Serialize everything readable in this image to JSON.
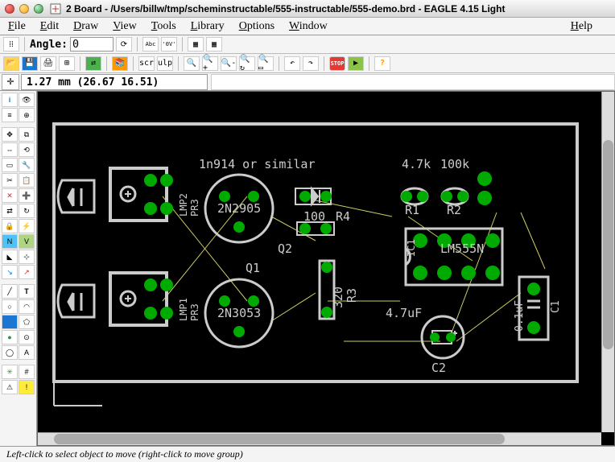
{
  "window": {
    "title": "2 Board - /Users/billw/tmp/scheminstructable/555-instructable/555-demo.brd - EAGLE 4.15 Light"
  },
  "menu": {
    "file": "File",
    "edit": "Edit",
    "draw": "Draw",
    "view": "View",
    "tools": "Tools",
    "library": "Library",
    "options": "Options",
    "window": "Window",
    "help": "Help"
  },
  "toolbar": {
    "angle_label": "Angle:",
    "angle_value": "0"
  },
  "coords": {
    "text": "1.27 mm (26.67 16.51)"
  },
  "board": {
    "labels": {
      "diode_note": "1n914 or similar",
      "r_note_k1": "4.7k",
      "r_note_k2": "100k",
      "q1_name": "Q1",
      "q1_val": "2N3053",
      "q2_name": "Q2",
      "q2_val": "2N2905",
      "r1": "R1",
      "r2": "R2",
      "r3": "R3",
      "r4": "R4",
      "r4_val": "100",
      "r3_val": "320",
      "lmp2": "LMP2",
      "pr3a": "PR3",
      "lmp1": "LMP1",
      "pr3b": "PR3",
      "ic1": "IC1",
      "ic1_val": "LM555N",
      "c1": "C1",
      "c1_val": "0.1uF",
      "c2": "C2",
      "c2_val": "4.7uF"
    }
  },
  "status": {
    "text": "Left-click to select object to move (right-click to move group)"
  }
}
